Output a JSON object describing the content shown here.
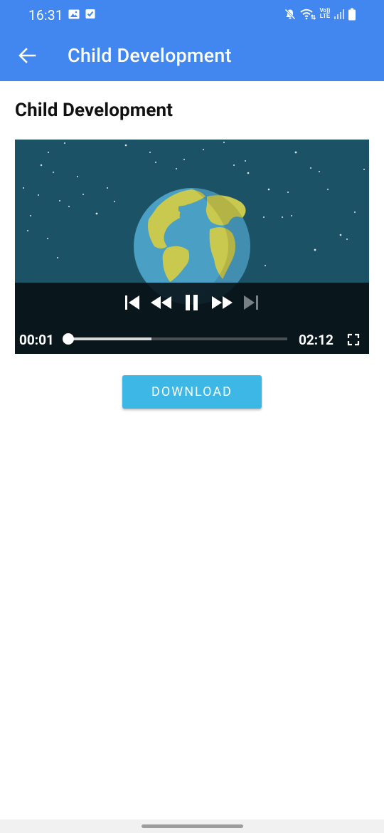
{
  "status_bar": {
    "time": "16:31",
    "left_icons": [
      "image-notification-icon",
      "checkbox-notification-icon"
    ],
    "right_icons": [
      "mute-icon",
      "wifi-icon",
      "volte-icon",
      "signal-icon",
      "battery-icon"
    ],
    "volte_text": "Vo)) LTE"
  },
  "app_bar": {
    "title": "Child Development",
    "back_icon": "arrow-left-icon",
    "color": "#4287f0"
  },
  "content": {
    "heading": "Child Development"
  },
  "video_player": {
    "position": "00:01",
    "duration": "02:12",
    "progress_played": 0.0,
    "progress_buffered": 0.38,
    "controls": [
      "skip-previous-icon",
      "rewind-icon",
      "pause-icon",
      "fast-forward-icon",
      "skip-next-icon"
    ],
    "fullscreen_icon": "fullscreen-icon"
  },
  "download_button": {
    "label": "DOWNLOAD",
    "color": "#3cb7e6"
  }
}
